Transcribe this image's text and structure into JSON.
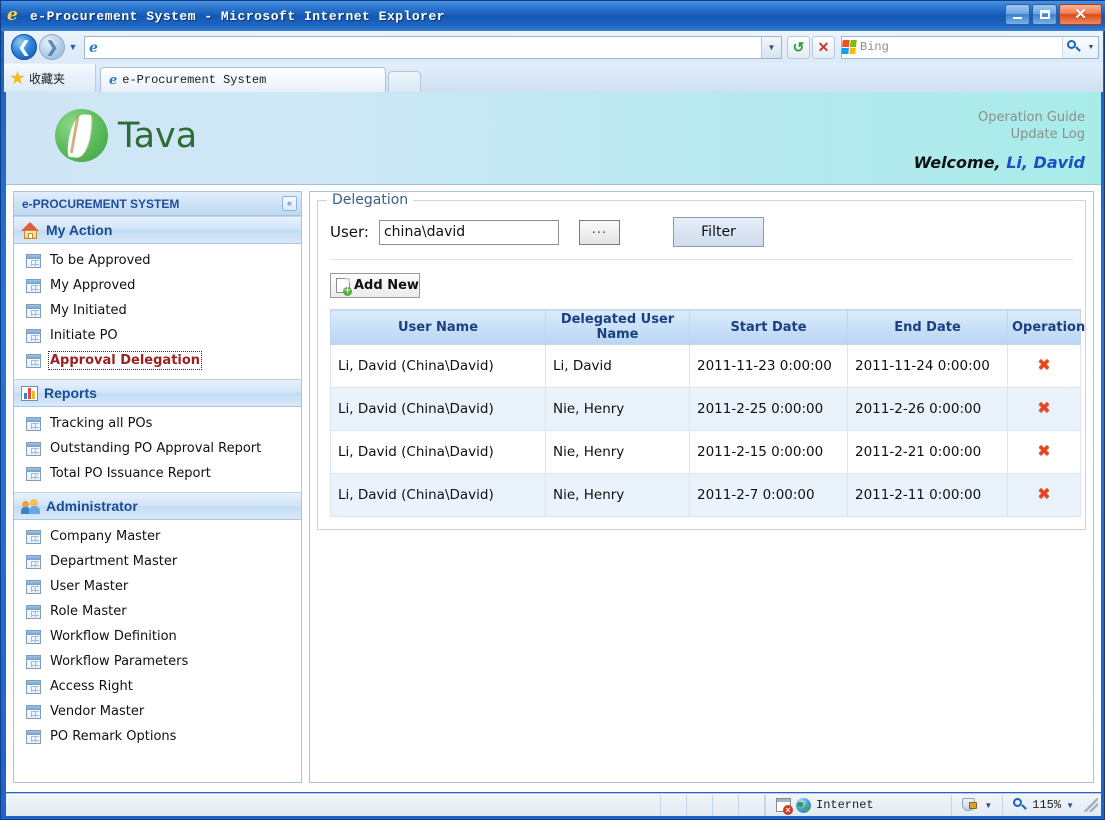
{
  "browser": {
    "window_title": "e-Procurement System - Microsoft Internet Explorer",
    "minimize_label": "Minimize",
    "maximize_label": "Maximize",
    "close_label": "Close",
    "back_label": "Back",
    "forward_label": "Forward",
    "history_label": "Recent Pages",
    "address_value": "",
    "address_placeholder": "",
    "refresh_label": "Refresh",
    "stop_label": "Stop",
    "search_provider": "Bing",
    "search_go_label": "Search",
    "favorites_label": "收藏夹",
    "tab_label": "e-Procurement System",
    "new_tab_label": "New Tab"
  },
  "status": {
    "zone_label": "Internet",
    "zoom_label": "115%",
    "protected_mode_label": "Protected Mode"
  },
  "header": {
    "brand": "Tava",
    "title": "e-Procurement System",
    "links": [
      {
        "label": "Operation Guide"
      },
      {
        "label": "Update Log"
      }
    ],
    "welcome_prefix": "Welcome,",
    "welcome_user": "Li, David"
  },
  "sidebar": {
    "title": "e-PROCUREMENT SYSTEM",
    "collapse_label": "«",
    "groups": [
      {
        "label": "My Action",
        "icon": "home-icon",
        "items": [
          {
            "label": "To be Approved",
            "active": false
          },
          {
            "label": "My Approved",
            "active": false
          },
          {
            "label": "My Initiated",
            "active": false
          },
          {
            "label": "Initiate PO",
            "active": false
          },
          {
            "label": "Approval Delegation",
            "active": true
          }
        ]
      },
      {
        "label": "Reports",
        "icon": "chart-icon",
        "items": [
          {
            "label": "Tracking all POs",
            "active": false
          },
          {
            "label": "Outstanding PO Approval Report",
            "active": false
          },
          {
            "label": "Total PO Issuance Report",
            "active": false
          }
        ]
      },
      {
        "label": "Administrator",
        "icon": "users-icon",
        "items": [
          {
            "label": "Company Master",
            "active": false
          },
          {
            "label": "Department Master",
            "active": false
          },
          {
            "label": "User Master",
            "active": false
          },
          {
            "label": "Role Master",
            "active": false
          },
          {
            "label": "Workflow Definition",
            "active": false
          },
          {
            "label": "Workflow Parameters",
            "active": false
          },
          {
            "label": "Access Right",
            "active": false
          },
          {
            "label": "Vendor Master",
            "active": false
          },
          {
            "label": "PO Remark Options",
            "active": false
          }
        ]
      }
    ]
  },
  "main": {
    "panel_legend": "Delegation",
    "user_label": "User:",
    "user_value": "china\\david",
    "user_placeholder": "",
    "browse_label": "...",
    "filter_label": "Filter",
    "add_new_label": "Add New",
    "table": {
      "columns": [
        "User Name",
        "Delegated User Name",
        "Start Date",
        "End Date",
        "Operation"
      ],
      "delete_glyph": "✖",
      "rows": [
        {
          "user_name": "Li, David (China\\David)",
          "delegated_user": "Li, David",
          "start_date": "2011-11-23 0:00:00",
          "end_date": "2011-11-24 0:00:00"
        },
        {
          "user_name": "Li, David (China\\David)",
          "delegated_user": "Nie, Henry",
          "start_date": "2011-2-25 0:00:00",
          "end_date": "2011-2-26 0:00:00"
        },
        {
          "user_name": "Li, David (China\\David)",
          "delegated_user": "Nie, Henry",
          "start_date": "2011-2-15 0:00:00",
          "end_date": "2011-2-21 0:00:00"
        },
        {
          "user_name": "Li, David (China\\David)",
          "delegated_user": "Nie, Henry",
          "start_date": "2011-2-7 0:00:00",
          "end_date": "2011-2-11 0:00:00"
        }
      ]
    }
  },
  "colors": {
    "accent_blue": "#1b4fc4",
    "active_item": "#9c2020",
    "header_left": "#cfe5f5",
    "header_right": "#a8ece9",
    "brand_green": "#3f9f43",
    "delete_red": "#e8441f"
  }
}
